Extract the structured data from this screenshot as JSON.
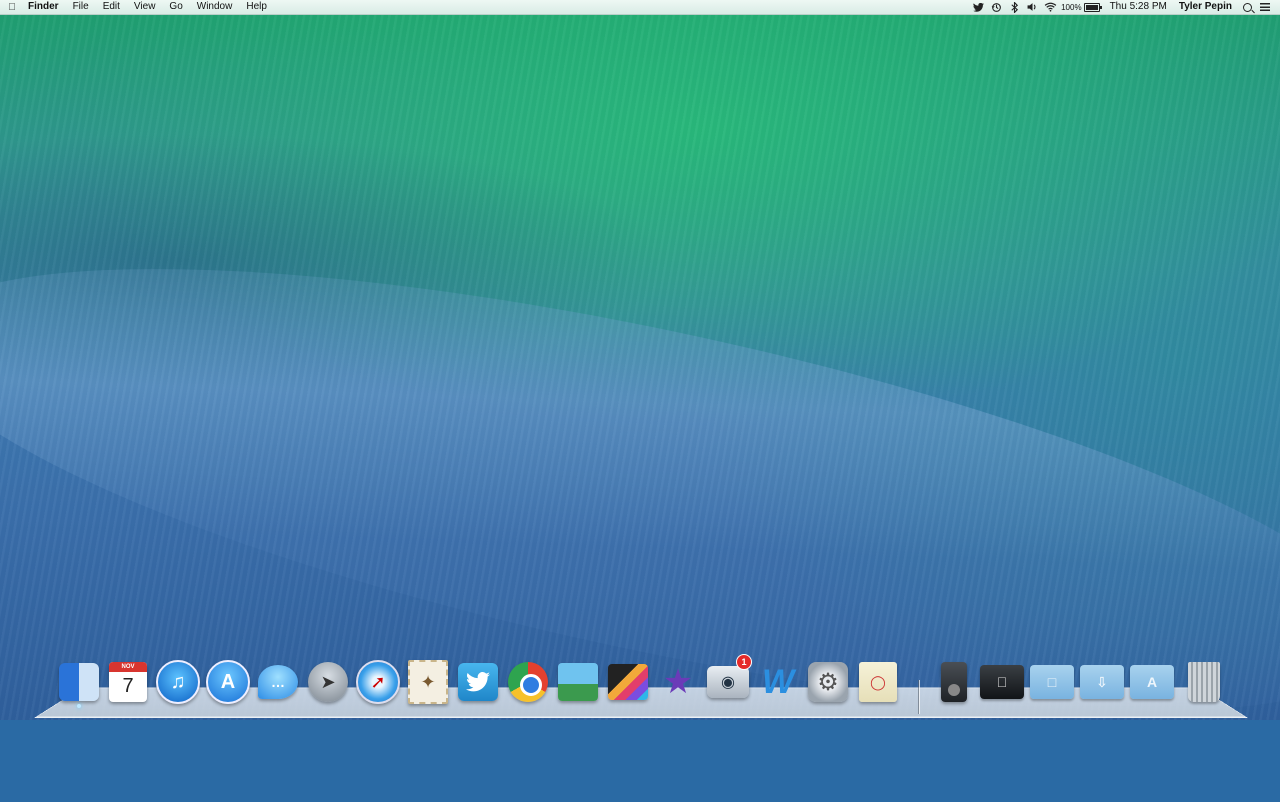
{
  "menubar": {
    "app_name": "Finder",
    "menus": [
      "File",
      "Edit",
      "View",
      "Go",
      "Window",
      "Help"
    ],
    "status": {
      "battery_percent": "100%",
      "clock": "Thu 5:28 PM",
      "user": "Tyler Pepin"
    },
    "status_icons": [
      "twitter-icon",
      "time-machine-icon",
      "bluetooth-icon",
      "volume-icon",
      "wifi-icon",
      "battery-icon",
      "spotlight-icon",
      "notification-center-icon"
    ]
  },
  "desktop": {
    "wallpaper": "wave"
  },
  "dock": {
    "calendar": {
      "month": "NOV",
      "day": "7"
    },
    "facetime_badge": "1",
    "apps": [
      "finder",
      "calendar",
      "itunes",
      "app-store",
      "messages",
      "launchpad",
      "safari",
      "mail",
      "twitter",
      "chrome",
      "iphoto",
      "final-cut-pro",
      "imovie",
      "facetime",
      "word",
      "system-preferences",
      "preview"
    ],
    "stacks": [
      "ipod",
      "apple-folder",
      "documents-folder",
      "downloads-folder",
      "applications-folder",
      "trash"
    ]
  },
  "colors": {
    "menubar_bg": "#e6f4ef",
    "wave_green": "#1ea06e",
    "wave_blue": "#3d78b0"
  }
}
